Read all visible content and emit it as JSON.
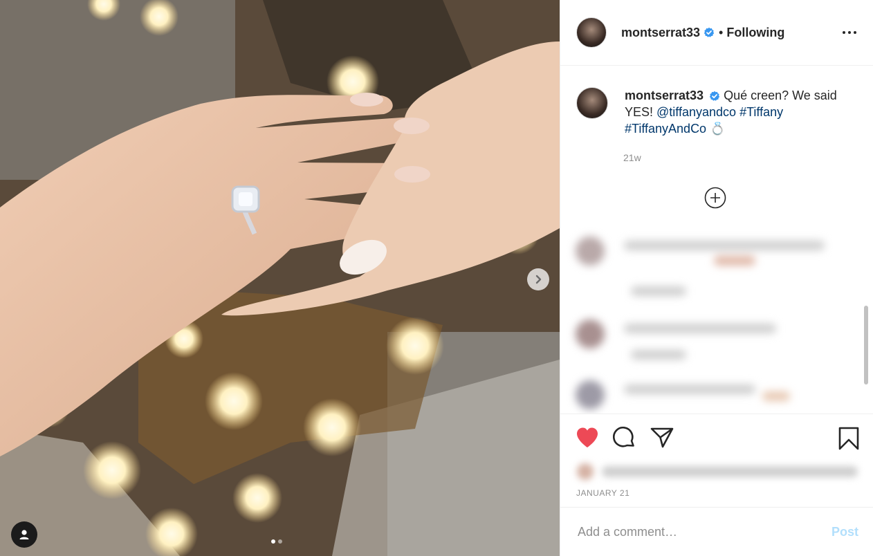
{
  "post": {
    "username": "montserrat33",
    "separator": "•",
    "follow_status": "Following",
    "verified_icon": "verified-badge-icon",
    "more_icon": "more-options-icon"
  },
  "caption": {
    "username": "montserrat33",
    "text_1": " Qué creen? We said YES! ",
    "mention": "@tiffanyandco",
    "hashtag_1": "#Tiffany",
    "hashtag_2": "#TiffanyAndCo",
    "emoji": "💍",
    "time": "21w"
  },
  "actions": {
    "like_icon": "heart-filled-icon",
    "comment_icon": "comment-icon",
    "share_icon": "share-icon",
    "save_icon": "bookmark-icon",
    "like_color": "#ed4956"
  },
  "date": "JANUARY 21",
  "comment": {
    "placeholder": "Add a comment…",
    "post_label": "Post",
    "post_color": "#b2dffc"
  },
  "carousel": {
    "current_index": 1,
    "total": 2
  }
}
